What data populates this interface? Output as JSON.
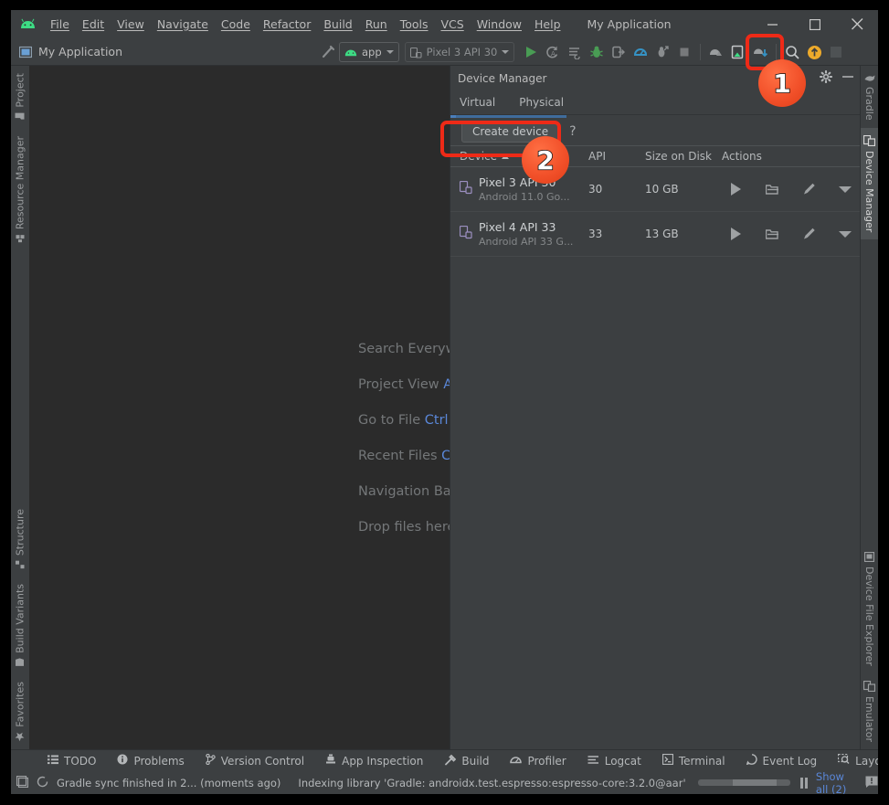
{
  "window": {
    "title": "My Application",
    "minimize_label": "—",
    "maximize_label": "☐",
    "close_label": "✕"
  },
  "menubar": {
    "logo": "android-logo",
    "items": [
      {
        "label": "File",
        "mnemonic": "F"
      },
      {
        "label": "Edit",
        "mnemonic": "E"
      },
      {
        "label": "View",
        "mnemonic": "V"
      },
      {
        "label": "Navigate",
        "mnemonic": "N"
      },
      {
        "label": "Code",
        "mnemonic": "C"
      },
      {
        "label": "Refactor",
        "mnemonic": "R"
      },
      {
        "label": "Build",
        "mnemonic": "B"
      },
      {
        "label": "Run",
        "mnemonic": "u"
      },
      {
        "label": "Tools",
        "mnemonic": "T"
      },
      {
        "label": "VCS",
        "mnemonic": "S"
      },
      {
        "label": "Window",
        "mnemonic": "W"
      },
      {
        "label": "Help",
        "mnemonic": "H"
      }
    ]
  },
  "toolbar": {
    "project_name": "My Application",
    "run_config": "app",
    "device_target": "Pixel 3 API 30",
    "icons": [
      "run-icon",
      "rerun-icon",
      "apply-changes-icon",
      "debug-icon",
      "attach-debugger-icon",
      "profiler-icon",
      "run-with-coverage-icon",
      "stop-icon"
    ],
    "right_icons": [
      "avd-manager-icon",
      "device-manager-icon",
      "sdk-manager-icon",
      "search-icon",
      "update-icon",
      "settings-icon"
    ]
  },
  "left_stripe": {
    "items": [
      {
        "label": "Project",
        "icon": "project-icon"
      },
      {
        "label": "Resource Manager",
        "icon": "resource-manager-icon"
      },
      {
        "label": "Structure",
        "icon": "structure-icon"
      },
      {
        "label": "Build Variants",
        "icon": "build-variants-icon"
      },
      {
        "label": "Favorites",
        "icon": "favorites-star-icon"
      }
    ]
  },
  "right_stripe": {
    "items": [
      {
        "label": "Gradle",
        "icon": "gradle-elephant-icon",
        "active": false
      },
      {
        "label": "Device Manager",
        "icon": "device-manager-icon",
        "active": true
      },
      {
        "label": "Device File Explorer",
        "icon": "device-file-explorer-icon",
        "active": false
      },
      {
        "label": "Emulator",
        "icon": "emulator-icon",
        "active": false
      }
    ]
  },
  "editor": {
    "hints": [
      {
        "action": "Search Everywhere",
        "key": ""
      },
      {
        "action": "Project View",
        "key": "Al"
      },
      {
        "action": "Go to File",
        "key": "Ctrl+"
      },
      {
        "action": "Recent Files",
        "key": "Ct"
      },
      {
        "action": "Navigation Bar",
        "key": ""
      },
      {
        "action": "Drop files here",
        "key": ""
      }
    ]
  },
  "device_manager": {
    "title": "Device Manager",
    "gear_icon": "gear-icon",
    "minimize_icon": "minimize-icon",
    "tabs": [
      {
        "label": "Virtual",
        "active": true
      },
      {
        "label": "Physical",
        "active": false
      }
    ],
    "create_device_label": "Create device",
    "help_label": "?",
    "columns": [
      "Device",
      "API",
      "Size on Disk",
      "Actions"
    ],
    "sort_column": "Device",
    "sort_direction": "asc",
    "rows": [
      {
        "icon": "virtual-device-icon",
        "name": "Pixel 3 API 30",
        "subtitle": "Android 11.0 Go...",
        "api": "30",
        "size_on_disk": "10 GB",
        "actions": [
          "launch-icon",
          "folder-icon",
          "edit-pencil-icon",
          "dropdown-icon"
        ]
      },
      {
        "icon": "virtual-device-icon",
        "name": "Pixel 4 API 33",
        "subtitle": "Android API 33 G...",
        "api": "33",
        "size_on_disk": "13 GB",
        "actions": [
          "launch-icon",
          "folder-icon",
          "edit-pencil-icon",
          "dropdown-icon"
        ]
      }
    ]
  },
  "tool_windows": [
    {
      "label": "TODO",
      "icon": "todo-icon"
    },
    {
      "label": "Problems",
      "icon": "problems-icon"
    },
    {
      "label": "Version Control",
      "icon": "version-control-icon"
    },
    {
      "label": "App Inspection",
      "icon": "app-inspection-icon"
    },
    {
      "label": "Build",
      "icon": "build-hammer-icon"
    },
    {
      "label": "Profiler",
      "icon": "profiler-icon"
    },
    {
      "label": "Logcat",
      "icon": "logcat-icon"
    },
    {
      "label": "Terminal",
      "icon": "terminal-icon"
    },
    {
      "label": "Event Log",
      "icon": "event-log-icon"
    },
    {
      "label": "Layout Inspector",
      "icon": "layout-inspector-icon"
    }
  ],
  "statusbar": {
    "left_icon": "window-icon",
    "sync_icon": "refresh-spinner-icon",
    "sync_text": "Gradle sync finished in 2... (moments ago)",
    "indexing_text": "Indexing library 'Gradle: androidx.test.espresso:espresso-core:3.2.0@aar'",
    "pause_icon": "pause-icon",
    "show_all_label": "Show all (2)",
    "notification_icon": "notification-icon"
  },
  "annotations": [
    {
      "number": "1",
      "target": "device-manager-toolbar-icon"
    },
    {
      "number": "2",
      "target": "create-device-button"
    }
  ],
  "colors": {
    "accent_red": "#ee2a17",
    "badge_orange": "#f2512a",
    "link_blue": "#5a87d8",
    "android_green": "#3ddc84",
    "panel_bg": "#3c3f41",
    "editor_bg": "#2b2b2b"
  }
}
